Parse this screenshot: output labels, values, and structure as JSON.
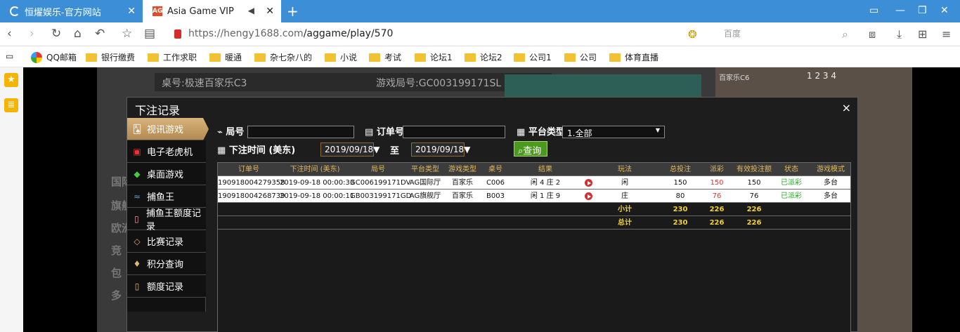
{
  "browser": {
    "tabs": [
      {
        "title": "恒燿娱乐-官方网站"
      },
      {
        "title": "Asia Game VIP",
        "favicon": "AG"
      }
    ],
    "url": {
      "host": "https://hengy1688.com",
      "path": "/aggame/play/570"
    },
    "search_placeholder": "百度",
    "bookmarks": [
      "QQ邮箱",
      "银行缴费",
      "工作求职",
      "暖通",
      "杂七杂八的",
      "小说",
      "考试",
      "论坛1",
      "论坛2",
      "公司1",
      "公司",
      "体育直播"
    ]
  },
  "background": {
    "table_name": "桌号:极速百家乐C3",
    "game_round": "游戏局号:GC003199171SL",
    "side_labels": [
      "国际",
      "旗舰",
      "欧洲",
      "竞",
      "包",
      "多"
    ],
    "video_label": "百家乐C6",
    "video_numbers": "1 2 3 4"
  },
  "modal": {
    "title": "下注记录",
    "close": "×",
    "menu": [
      {
        "label": "视讯游戏",
        "icon": "cards-icon",
        "active": true
      },
      {
        "label": "电子老虎机",
        "icon": "slot-icon"
      },
      {
        "label": "桌面游戏",
        "icon": "chip-icon"
      },
      {
        "label": "捕鱼王",
        "icon": "fish-icon"
      },
      {
        "label": "捕鱼王额度记录",
        "icon": "doc-icon"
      },
      {
        "label": "比赛记录",
        "icon": "ticket-icon"
      },
      {
        "label": "积分查询",
        "icon": "diamond-icon"
      },
      {
        "label": "额度记录",
        "icon": "doc-icon"
      }
    ],
    "filters": {
      "round_label": "局号",
      "round_value": "",
      "order_label": "订单号",
      "order_value": "",
      "platform_label": "平台类型",
      "platform_value": "1.全部",
      "time_label": "下注时间 (美东)",
      "date_from": "2019/09/18▼",
      "to_label": "至",
      "date_to": "2019/09/18▼",
      "query": "查询"
    },
    "table": {
      "headers": [
        "订单号",
        "下注时间 (美东)",
        "局号",
        "平台类型",
        "游戏类型",
        "桌号",
        "结果",
        "",
        "玩法",
        "总投注",
        "派彩",
        "有效投注额",
        "状态",
        "游戏模式"
      ],
      "rows": [
        [
          "190918004279358",
          "2019-09-18 00:00:33",
          "GC006199171DV",
          "AG国际厅",
          "百家乐",
          "C006",
          "闲 4 庄 2",
          "",
          "闲",
          "150",
          "150",
          "150",
          "已派彩",
          "多台"
        ],
        [
          "190918004268739",
          "2019-09-18 00:00:11",
          "GB003199171GD",
          "AG旗舰厅",
          "百家乐",
          "B003",
          "闲 1 庄 9",
          "",
          "庄",
          "80",
          "76",
          "76",
          "已派彩",
          "多台"
        ]
      ],
      "subtotal": {
        "label": "小计",
        "bet": "230",
        "payout": "226",
        "valid": "226"
      },
      "total": {
        "label": "总计",
        "bet": "230",
        "payout": "226",
        "valid": "226"
      }
    }
  }
}
